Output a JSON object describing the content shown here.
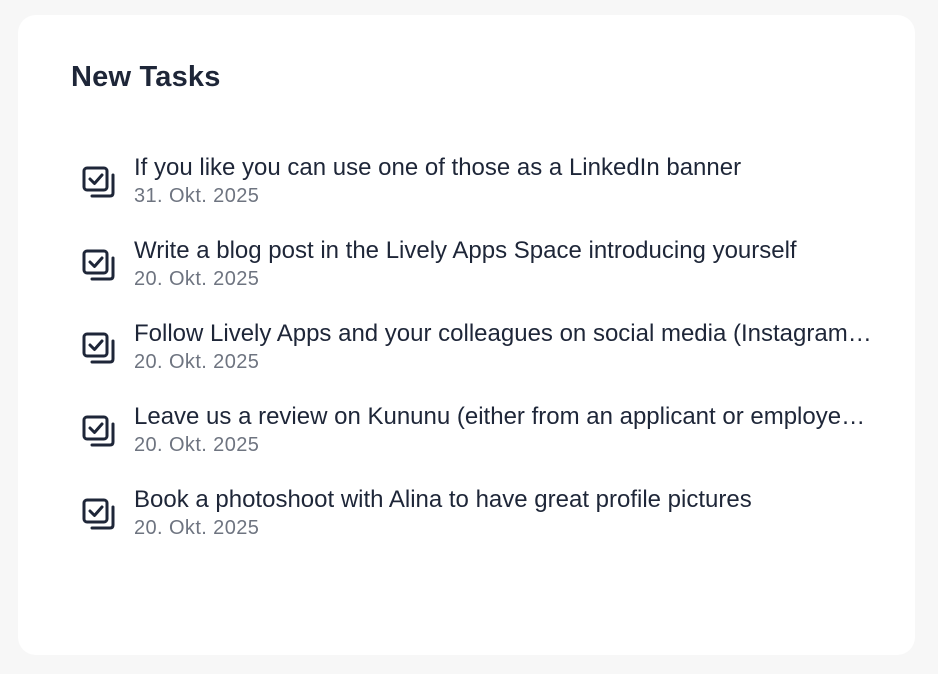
{
  "card": {
    "title": "New Tasks"
  },
  "tasks": [
    {
      "icon": "task-checkbox-icon",
      "title": "If you like you can use one of those as a LinkedIn banner",
      "date": "31. Okt. 2025"
    },
    {
      "icon": "task-checkbox-icon",
      "title": "Write a blog post in the Lively Apps Space introducing yourself",
      "date": "20. Okt. 2025"
    },
    {
      "icon": "task-checkbox-icon",
      "title": "Follow Lively Apps and your colleagues on social media (Instagram, LinkedIn)",
      "date": "20. Okt. 2025"
    },
    {
      "icon": "task-checkbox-icon",
      "title": "Leave us a review on Kununu (either from an applicant or employee perspective)",
      "date": "20. Okt. 2025"
    },
    {
      "icon": "task-checkbox-icon",
      "title": "Book a photoshoot with Alina to have great profile pictures",
      "date": "20. Okt. 2025"
    }
  ],
  "colors": {
    "background": "#f7f7f7",
    "card": "#ffffff",
    "text_primary": "#1e2638",
    "text_secondary": "#6e7480"
  }
}
